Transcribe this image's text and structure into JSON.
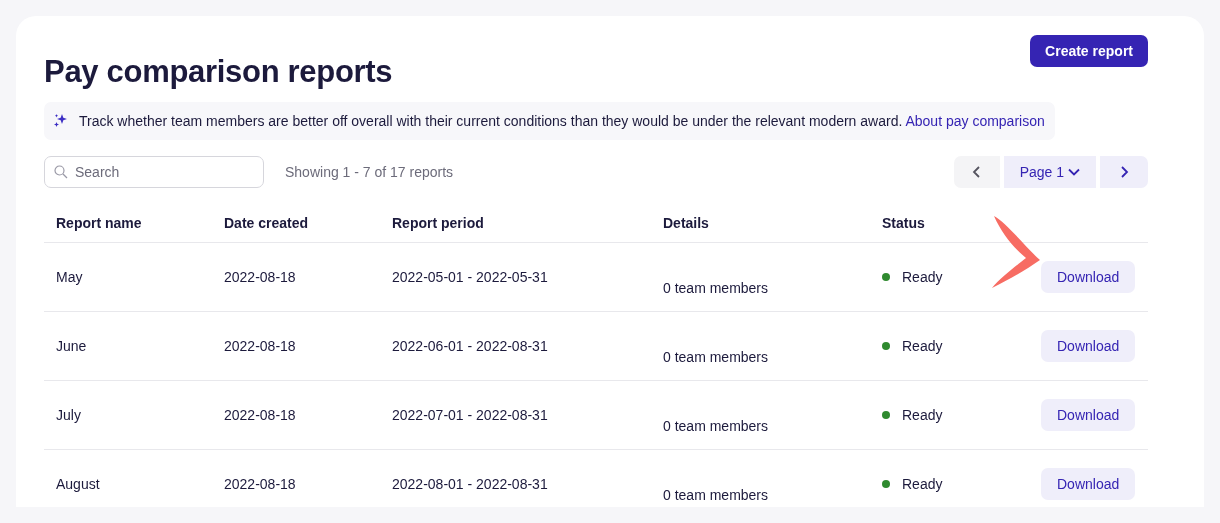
{
  "title": "Pay comparison reports",
  "create_button": "Create report",
  "banner": {
    "text": "Track whether team members are better off overall with their current conditions than they would be under the relevant modern award.",
    "link": "About pay comparison"
  },
  "search": {
    "placeholder": "Search"
  },
  "showing": "Showing 1 - 7 of 17 reports",
  "pagination": {
    "page": "Page 1"
  },
  "table": {
    "columns": [
      "Report name",
      "Date created",
      "Report period",
      "Details",
      "Status"
    ],
    "rows": [
      {
        "name": "May",
        "date": "2022-08-18",
        "period": "2022-05-01 - 2022-05-31",
        "details": "0 team members",
        "status": "Ready",
        "color": "#2f8a2f",
        "action": "Download"
      },
      {
        "name": "June",
        "date": "2022-08-18",
        "period": "2022-06-01 - 2022-08-31",
        "details": "0 team members",
        "status": "Ready",
        "color": "#2f8a2f",
        "action": "Download"
      },
      {
        "name": "July",
        "date": "2022-08-18",
        "period": "2022-07-01 - 2022-08-31",
        "details": "0 team members",
        "status": "Ready",
        "color": "#2f8a2f",
        "action": "Download"
      },
      {
        "name": "August",
        "date": "2022-08-18",
        "period": "2022-08-01 - 2022-08-31",
        "details": "0 team members",
        "status": "Ready",
        "color": "#2f8a2f",
        "action": "Download"
      }
    ]
  }
}
